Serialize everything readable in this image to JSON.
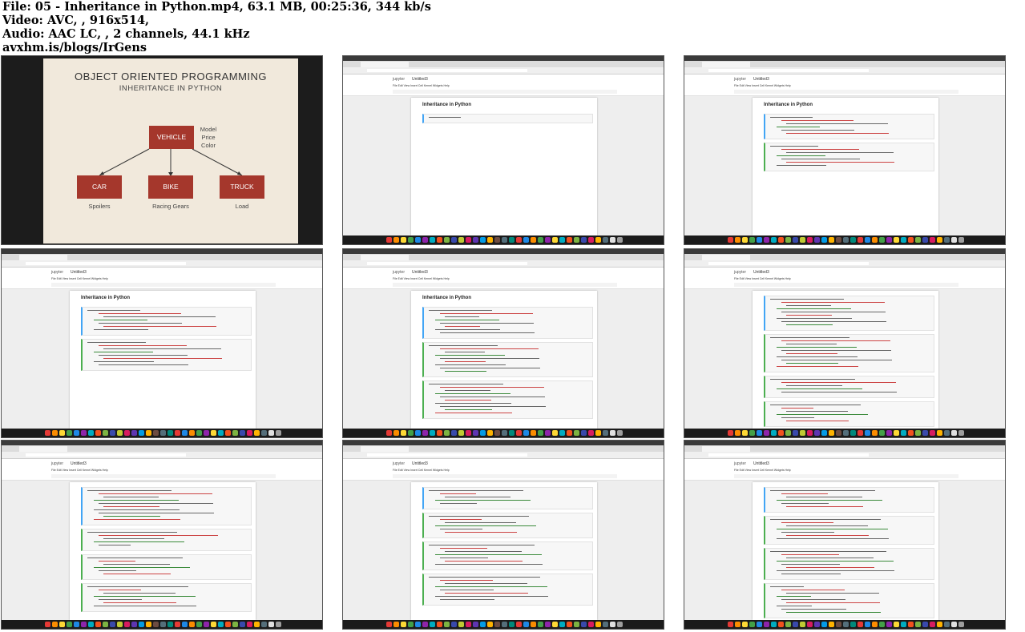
{
  "info": {
    "file_line": "File: 05 - Inheritance in Python.mp4, 63.1 MB, 00:25:36, 344 kb/s",
    "video_line": "Video: AVC, , 916x514,",
    "audio_line": "Audio: AAC LC, , 2 channels, 44.1 kHz",
    "site_line": "avxhm.is/blogs/IrGens"
  },
  "slide": {
    "title": "OBJECT ORIENTED PROGRAMMING",
    "subtitle": "INHERITANCE IN PYTHON",
    "parent": "VEHICLE",
    "parent_attrs": [
      "Model",
      "Price",
      "Color"
    ],
    "children": [
      {
        "label": "CAR",
        "note": "Spoilers"
      },
      {
        "label": "BIKE",
        "note": "Racing Gears"
      },
      {
        "label": "TRUCK",
        "note": "Load"
      }
    ],
    "bg_color": "#f1e9dc",
    "box_color": "#a5372c"
  },
  "notebook": {
    "logo": "jupyter",
    "title": "Untitled3",
    "menu": "File  Edit  View  Insert  Cell  Kernel  Widgets  Help",
    "heading": "Inheritance in Python"
  },
  "dock_colors": [
    "#e53935",
    "#fb8c00",
    "#fdd835",
    "#43a047",
    "#1e88e5",
    "#8e24aa",
    "#00acc1",
    "#f4511e",
    "#7cb342",
    "#3949ab",
    "#c0ca33",
    "#d81b60",
    "#5e35b1",
    "#039be5",
    "#ffb300",
    "#6d4c41",
    "#546e7a",
    "#00897b",
    "#e53935",
    "#1e88e5",
    "#fb8c00",
    "#43a047",
    "#8e24aa",
    "#fdd835",
    "#00acc1",
    "#f4511e",
    "#7cb342",
    "#3949ab",
    "#d81b60",
    "#ffb300",
    "#546e7a",
    "#e0e0e0",
    "#9e9e9e"
  ]
}
